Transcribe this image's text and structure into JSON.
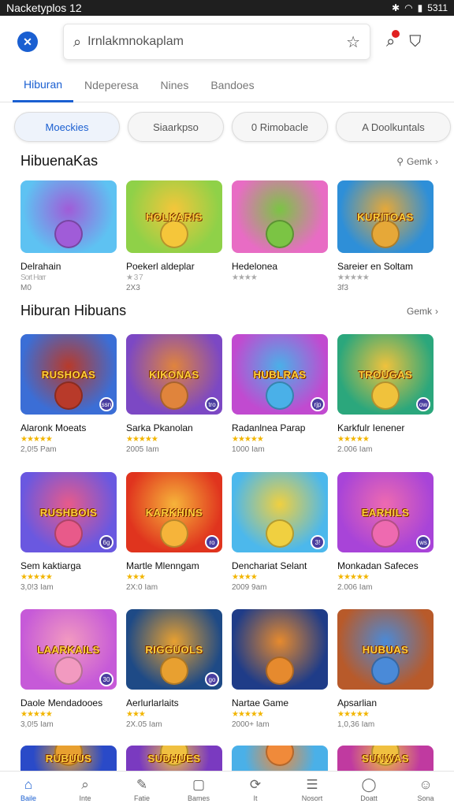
{
  "status_bar": {
    "title": "Nacketyplos 12",
    "time": "5311"
  },
  "search": {
    "value": "Irnlakmnokaplam"
  },
  "tabs": [
    "Hiburan",
    "Ndeperesa",
    "Nines",
    "Bandoes"
  ],
  "chips": [
    "Moeckies",
    "Siaarkpso",
    "0 Rimobacle",
    "A Doolkuntals"
  ],
  "section1": {
    "title": "HibuenaKas",
    "link": "Gemk"
  },
  "section2": {
    "title": "Hiburan Hibuans",
    "link": "Gemk"
  },
  "row1": [
    {
      "name": "Delrahain",
      "stars": "Sort Harr",
      "size": "M0",
      "banner": "",
      "colors": [
        "#5ec2f2",
        "#a05cd8"
      ]
    },
    {
      "name": "Poekerl aldeplar",
      "stars": "★ 3 7",
      "size": "2X3",
      "banner": "HOLKARIS",
      "colors": [
        "#8fd148",
        "#f5c63a"
      ]
    },
    {
      "name": "Hedelonea",
      "stars": "★★★★",
      "size": "",
      "banner": "",
      "colors": [
        "#e86cc4",
        "#7bc444"
      ]
    },
    {
      "name": "Sareier en Soltam",
      "stars": "★★★★★",
      "size": "3f3",
      "banner": "KURITOAS",
      "colors": [
        "#2e8fd8",
        "#e6a838"
      ]
    }
  ],
  "row2": [
    {
      "name": "Alaronk Moeats",
      "stars": "★★★★★",
      "size": "2,0!5 Pam",
      "banner": "RUSHOAS",
      "badge": "ssn",
      "colors": [
        "#3b6ed6",
        "#b83a2a"
      ]
    },
    {
      "name": "Sarka Pkanolan",
      "stars": "★★★★★",
      "size": "2005 Iam",
      "banner": "KIKONAS",
      "badge": "tro",
      "colors": [
        "#7c48c4",
        "#e0843c"
      ]
    },
    {
      "name": "Radanlnea Parap",
      "stars": "★★★★★",
      "size": "1000 Iam",
      "banner": "HUBLRAS",
      "badge": "rjp",
      "colors": [
        "#c14ad0",
        "#4ab0e8"
      ]
    },
    {
      "name": "Karkfulr Ienener",
      "stars": "★★★★★",
      "size": "2.006 Iam",
      "banner": "TROUGAS",
      "badge": "ow",
      "colors": [
        "#2ba77c",
        "#f0c23c"
      ]
    }
  ],
  "row3": [
    {
      "name": "Sem kaktiarga",
      "stars": "★★★★★",
      "size": "3,0!3 Iam",
      "banner": "RUSHBOIS",
      "badge": "6g",
      "colors": [
        "#6a58e0",
        "#e85a8a"
      ]
    },
    {
      "name": "Martle Mlenngam",
      "stars": "★★★",
      "size": "2X:0 Iam",
      "banner": "KARKHINS",
      "badge": "ro",
      "colors": [
        "#e0341e",
        "#f6b43a"
      ]
    },
    {
      "name": "Denchariat Selant",
      "stars": "★★★★",
      "size": "2009 9am",
      "banner": "",
      "badge": "3!",
      "colors": [
        "#4cb8ec",
        "#f0d040"
      ]
    },
    {
      "name": "Monkadan Safeces",
      "stars": "★★★★★",
      "size": "2.006 Iam",
      "banner": "EARHILS",
      "badge": "ws",
      "colors": [
        "#a844d8",
        "#ee6ab0"
      ]
    }
  ],
  "row4": [
    {
      "name": "Daole Mendadooes",
      "stars": "★★★★★",
      "size": "3,0!5 Iam",
      "banner": "LAARKAILS",
      "badge": "30",
      "colors": [
        "#c65ad8",
        "#f29ac0"
      ]
    },
    {
      "name": "Aerlurlarlaits",
      "stars": "★★★",
      "size": "2X.05 Iam",
      "banner": "RIGGUOLS",
      "badge": "go",
      "colors": [
        "#1e4a86",
        "#e8a030"
      ]
    },
    {
      "name": "Nartae Game",
      "stars": "★★★★★",
      "size": "2000+ Iam",
      "banner": "",
      "badge": "",
      "colors": [
        "#1f3c88",
        "#e68a2e"
      ]
    },
    {
      "name": "Apsarlian",
      "stars": "★★★★★",
      "size": "1,0,36 Iam",
      "banner": "HUBUAS",
      "badge": "",
      "colors": [
        "#b85a2a",
        "#4a8ad8"
      ]
    }
  ],
  "row5": [
    {
      "banner": "RUBUUS",
      "colors": [
        "#2a4ac8",
        "#e8a030"
      ]
    },
    {
      "banner": "SUDHUES",
      "colors": [
        "#7a3ac0",
        "#f0c040"
      ]
    },
    {
      "banner": "",
      "colors": [
        "#4ab0e8",
        "#f08a3a"
      ]
    },
    {
      "banner": "SUNWAS",
      "colors": [
        "#c03aa0",
        "#f0c040"
      ]
    }
  ],
  "bottom_nav": [
    {
      "label": "Baile",
      "icon": "home-icon",
      "glyph": "⌂"
    },
    {
      "label": "Inte",
      "icon": "search-icon",
      "glyph": "⌕"
    },
    {
      "label": "Fatie",
      "icon": "edit-icon",
      "glyph": "✎"
    },
    {
      "label": "Bames",
      "icon": "square-icon",
      "glyph": "▢"
    },
    {
      "label": "It",
      "icon": "refresh-icon",
      "glyph": "⟳"
    },
    {
      "label": "Nosort",
      "icon": "message-icon",
      "glyph": "☰"
    },
    {
      "label": "Doatt",
      "icon": "circle-icon",
      "glyph": "◯"
    },
    {
      "label": "Sona",
      "icon": "profile-icon",
      "glyph": "☺"
    }
  ],
  "accent": "#1a5fd1"
}
